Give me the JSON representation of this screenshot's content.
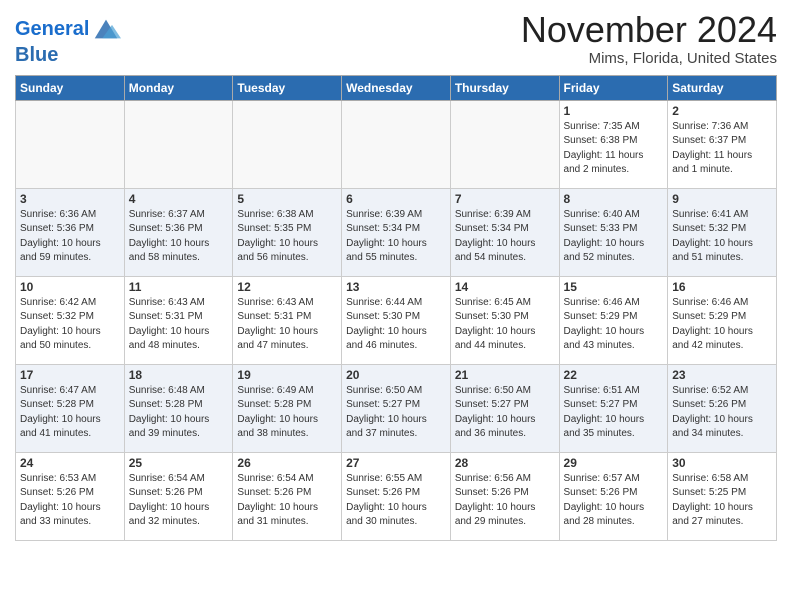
{
  "logo": {
    "line1": "General",
    "line2": "Blue"
  },
  "title": "November 2024",
  "location": "Mims, Florida, United States",
  "weekdays": [
    "Sunday",
    "Monday",
    "Tuesday",
    "Wednesday",
    "Thursday",
    "Friday",
    "Saturday"
  ],
  "weeks": [
    [
      {
        "day": "",
        "info": ""
      },
      {
        "day": "",
        "info": ""
      },
      {
        "day": "",
        "info": ""
      },
      {
        "day": "",
        "info": ""
      },
      {
        "day": "",
        "info": ""
      },
      {
        "day": "1",
        "info": "Sunrise: 7:35 AM\nSunset: 6:38 PM\nDaylight: 11 hours\nand 2 minutes."
      },
      {
        "day": "2",
        "info": "Sunrise: 7:36 AM\nSunset: 6:37 PM\nDaylight: 11 hours\nand 1 minute."
      }
    ],
    [
      {
        "day": "3",
        "info": "Sunrise: 6:36 AM\nSunset: 5:36 PM\nDaylight: 10 hours\nand 59 minutes."
      },
      {
        "day": "4",
        "info": "Sunrise: 6:37 AM\nSunset: 5:36 PM\nDaylight: 10 hours\nand 58 minutes."
      },
      {
        "day": "5",
        "info": "Sunrise: 6:38 AM\nSunset: 5:35 PM\nDaylight: 10 hours\nand 56 minutes."
      },
      {
        "day": "6",
        "info": "Sunrise: 6:39 AM\nSunset: 5:34 PM\nDaylight: 10 hours\nand 55 minutes."
      },
      {
        "day": "7",
        "info": "Sunrise: 6:39 AM\nSunset: 5:34 PM\nDaylight: 10 hours\nand 54 minutes."
      },
      {
        "day": "8",
        "info": "Sunrise: 6:40 AM\nSunset: 5:33 PM\nDaylight: 10 hours\nand 52 minutes."
      },
      {
        "day": "9",
        "info": "Sunrise: 6:41 AM\nSunset: 5:32 PM\nDaylight: 10 hours\nand 51 minutes."
      }
    ],
    [
      {
        "day": "10",
        "info": "Sunrise: 6:42 AM\nSunset: 5:32 PM\nDaylight: 10 hours\nand 50 minutes."
      },
      {
        "day": "11",
        "info": "Sunrise: 6:43 AM\nSunset: 5:31 PM\nDaylight: 10 hours\nand 48 minutes."
      },
      {
        "day": "12",
        "info": "Sunrise: 6:43 AM\nSunset: 5:31 PM\nDaylight: 10 hours\nand 47 minutes."
      },
      {
        "day": "13",
        "info": "Sunrise: 6:44 AM\nSunset: 5:30 PM\nDaylight: 10 hours\nand 46 minutes."
      },
      {
        "day": "14",
        "info": "Sunrise: 6:45 AM\nSunset: 5:30 PM\nDaylight: 10 hours\nand 44 minutes."
      },
      {
        "day": "15",
        "info": "Sunrise: 6:46 AM\nSunset: 5:29 PM\nDaylight: 10 hours\nand 43 minutes."
      },
      {
        "day": "16",
        "info": "Sunrise: 6:46 AM\nSunset: 5:29 PM\nDaylight: 10 hours\nand 42 minutes."
      }
    ],
    [
      {
        "day": "17",
        "info": "Sunrise: 6:47 AM\nSunset: 5:28 PM\nDaylight: 10 hours\nand 41 minutes."
      },
      {
        "day": "18",
        "info": "Sunrise: 6:48 AM\nSunset: 5:28 PM\nDaylight: 10 hours\nand 39 minutes."
      },
      {
        "day": "19",
        "info": "Sunrise: 6:49 AM\nSunset: 5:28 PM\nDaylight: 10 hours\nand 38 minutes."
      },
      {
        "day": "20",
        "info": "Sunrise: 6:50 AM\nSunset: 5:27 PM\nDaylight: 10 hours\nand 37 minutes."
      },
      {
        "day": "21",
        "info": "Sunrise: 6:50 AM\nSunset: 5:27 PM\nDaylight: 10 hours\nand 36 minutes."
      },
      {
        "day": "22",
        "info": "Sunrise: 6:51 AM\nSunset: 5:27 PM\nDaylight: 10 hours\nand 35 minutes."
      },
      {
        "day": "23",
        "info": "Sunrise: 6:52 AM\nSunset: 5:26 PM\nDaylight: 10 hours\nand 34 minutes."
      }
    ],
    [
      {
        "day": "24",
        "info": "Sunrise: 6:53 AM\nSunset: 5:26 PM\nDaylight: 10 hours\nand 33 minutes."
      },
      {
        "day": "25",
        "info": "Sunrise: 6:54 AM\nSunset: 5:26 PM\nDaylight: 10 hours\nand 32 minutes."
      },
      {
        "day": "26",
        "info": "Sunrise: 6:54 AM\nSunset: 5:26 PM\nDaylight: 10 hours\nand 31 minutes."
      },
      {
        "day": "27",
        "info": "Sunrise: 6:55 AM\nSunset: 5:26 PM\nDaylight: 10 hours\nand 30 minutes."
      },
      {
        "day": "28",
        "info": "Sunrise: 6:56 AM\nSunset: 5:26 PM\nDaylight: 10 hours\nand 29 minutes."
      },
      {
        "day": "29",
        "info": "Sunrise: 6:57 AM\nSunset: 5:26 PM\nDaylight: 10 hours\nand 28 minutes."
      },
      {
        "day": "30",
        "info": "Sunrise: 6:58 AM\nSunset: 5:25 PM\nDaylight: 10 hours\nand 27 minutes."
      }
    ]
  ]
}
